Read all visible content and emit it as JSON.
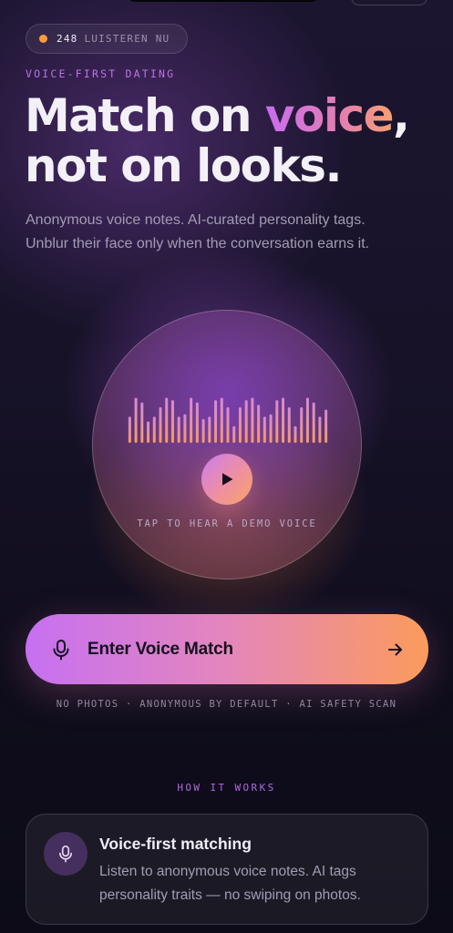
{
  "live": {
    "count": "248",
    "label": "LUISTEREN NU"
  },
  "hero": {
    "eyebrow": "VOICE-FIRST DATING",
    "headline_part1": "Match on ",
    "headline_accent": "voice",
    "headline_part2": ",",
    "headline_line2": "not on looks.",
    "subcopy": "Anonymous voice notes. AI-curated personality tags. Unblur their face only when the conversation earns it."
  },
  "demo": {
    "caption": "TAP TO HEAR A DEMO VOICE",
    "play_icon": "play-icon",
    "waveform_levels": [
      0.55,
      0.95,
      0.85,
      0.45,
      0.55,
      0.75,
      0.95,
      0.9,
      0.55,
      0.6,
      0.95,
      0.85,
      0.5,
      0.55,
      0.9,
      0.95,
      0.75,
      0.35,
      0.75,
      0.9,
      0.95,
      0.8,
      0.55,
      0.6,
      0.9,
      0.95,
      0.75,
      0.35,
      0.75,
      0.95,
      0.85,
      0.55,
      0.7
    ]
  },
  "cta": {
    "label": "Enter Voice Match",
    "mic_icon": "mic-icon",
    "arrow_icon": "arrow-right-icon"
  },
  "trust_line": "NO PHOTOS · ANONYMOUS BY DEFAULT · AI SAFETY SCAN",
  "how_it_works": {
    "eyebrow": "HOW IT WORKS",
    "features": [
      {
        "icon": "mic-icon",
        "title": "Voice-first matching",
        "description": "Listen to anonymous voice notes. AI tags personality traits — no swiping on photos."
      }
    ]
  },
  "colors": {
    "background": "#0e0d1a",
    "accent_purple": "#c670f2",
    "accent_pink": "#e486bc",
    "accent_orange": "#fb9b5c",
    "live_dot": "#ff9a3c"
  }
}
